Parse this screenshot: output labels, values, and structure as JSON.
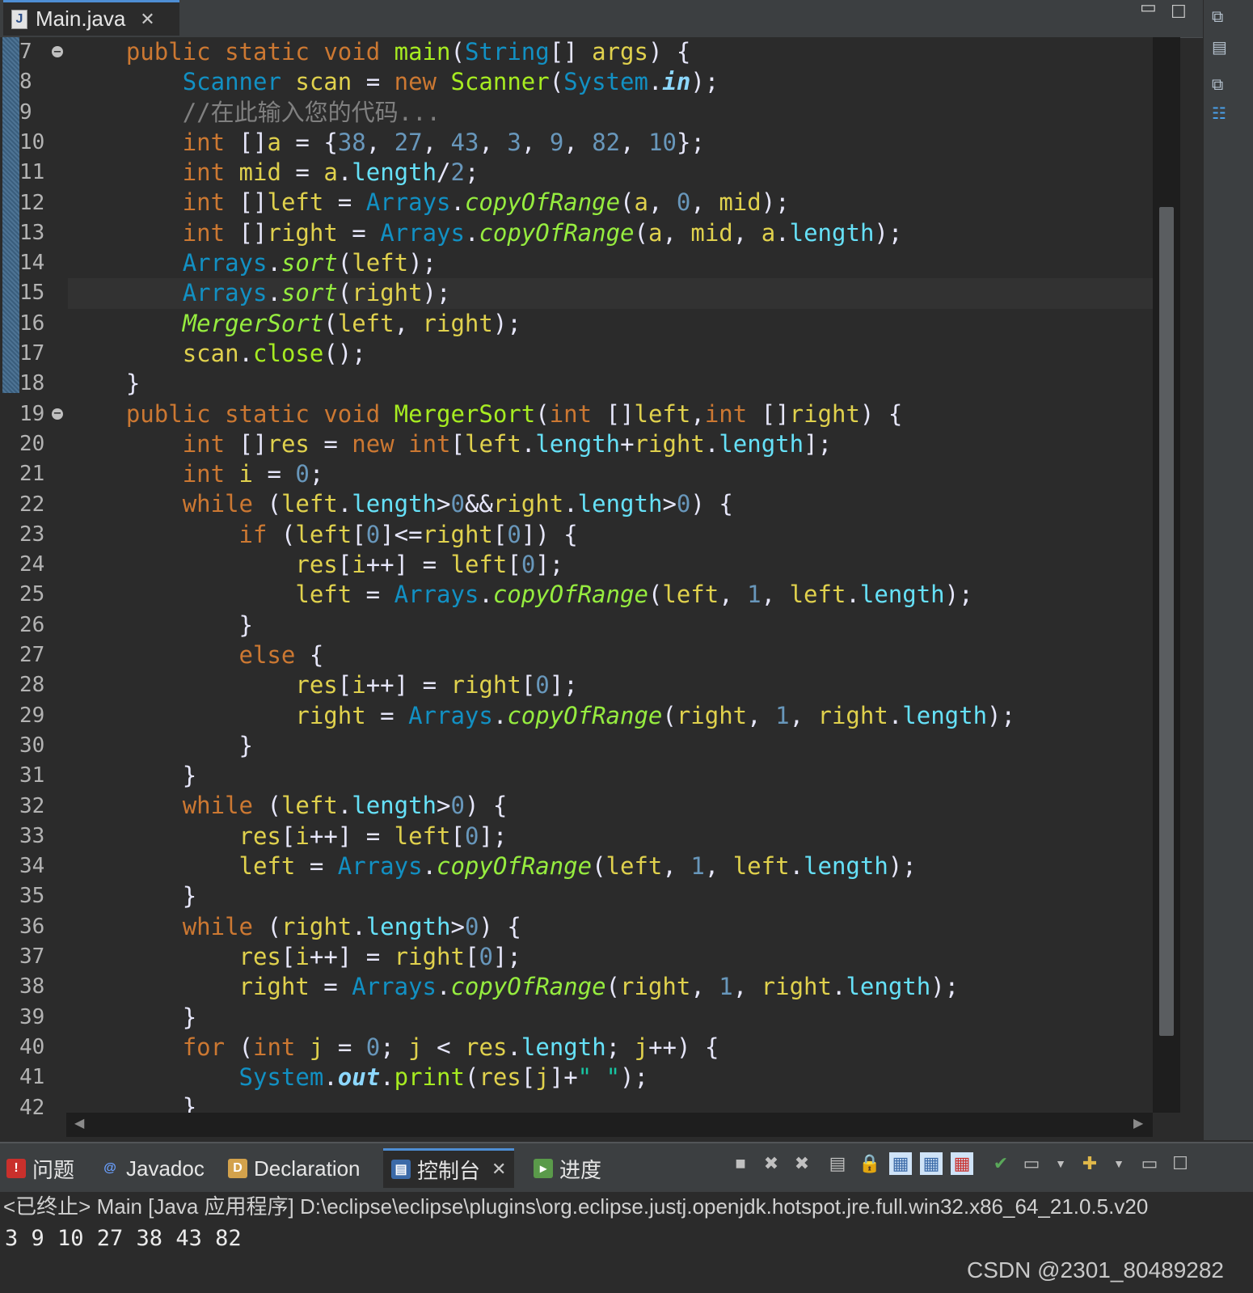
{
  "editor_tab": {
    "title": "Main.java"
  },
  "line_numbers": [
    "7",
    "8",
    "9",
    "10",
    "11",
    "12",
    "13",
    "14",
    "15",
    "16",
    "17",
    "18",
    "19",
    "20",
    "21",
    "22",
    "23",
    "24",
    "25",
    "26",
    "27",
    "28",
    "29",
    "30",
    "31",
    "32",
    "33",
    "34",
    "35",
    "36",
    "37",
    "38",
    "39",
    "40",
    "41",
    "42"
  ],
  "code_lines": [
    "    public static void main(String[] args) {",
    "        Scanner scan = new Scanner(System.in);",
    "        //在此输入您的代码...",
    "        int []a = {38, 27, 43, 3, 9, 82, 10};",
    "        int mid = a.length/2;",
    "        int []left = Arrays.copyOfRange(a, 0, mid);",
    "        int []right = Arrays.copyOfRange(a, mid, a.length);",
    "        Arrays.sort(left);",
    "        Arrays.sort(right);",
    "        MergerSort(left, right);",
    "        scan.close();",
    "    }",
    "    public static void MergerSort(int []left,int []right) {",
    "        int []res = new int[left.length+right.length];",
    "        int i = 0;",
    "        while (left.length>0&&right.length>0) {",
    "            if (left[0]<=right[0]) {",
    "                res[i++] = left[0];",
    "                left = Arrays.copyOfRange(left, 1, left.length);",
    "            }",
    "            else {",
    "                res[i++] = right[0];",
    "                right = Arrays.copyOfRange(right, 1, right.length);",
    "            }",
    "        }",
    "        while (left.length>0) {",
    "            res[i++] = left[0];",
    "            left = Arrays.copyOfRange(left, 1, left.length);",
    "        }",
    "        while (right.length>0) {",
    "            res[i++] = right[0];",
    "            right = Arrays.copyOfRange(right, 1, right.length);",
    "        }",
    "        for (int j = 0; j < res.length; j++) {",
    "            System.out.print(res[j]+\" \");",
    "        }"
  ],
  "bottom_tabs": {
    "problems": "问题",
    "javadoc": "Javadoc",
    "declaration": "Declaration",
    "console": "控制台",
    "progress": "进度"
  },
  "console": {
    "header": "<已终止> Main [Java 应用程序] D:\\eclipse\\eclipse\\plugins\\org.eclipse.justj.openjdk.hotspot.jre.full.win32.x86_64_21.0.5.v20",
    "output": "3 9 10 27 38 43 82"
  },
  "watermark": "CSDN @2301_80489282",
  "colors": {
    "keyword": "#cc7832",
    "type": "#1290c3",
    "comment": "#808080",
    "number": "#6897bb",
    "active_tab_accent": "#4e8ed4"
  },
  "icons": [
    "java-file-icon",
    "close-icon",
    "minimize-icon",
    "maximize-icon",
    "fold-icon",
    "problems-icon",
    "javadoc-icon",
    "declaration-icon",
    "console-icon",
    "progress-icon",
    "terminate-icon",
    "remove-launch-icon",
    "remove-all-icon",
    "scroll-lock-icon",
    "pin-console-icon",
    "display-console-icon",
    "new-console-icon"
  ]
}
